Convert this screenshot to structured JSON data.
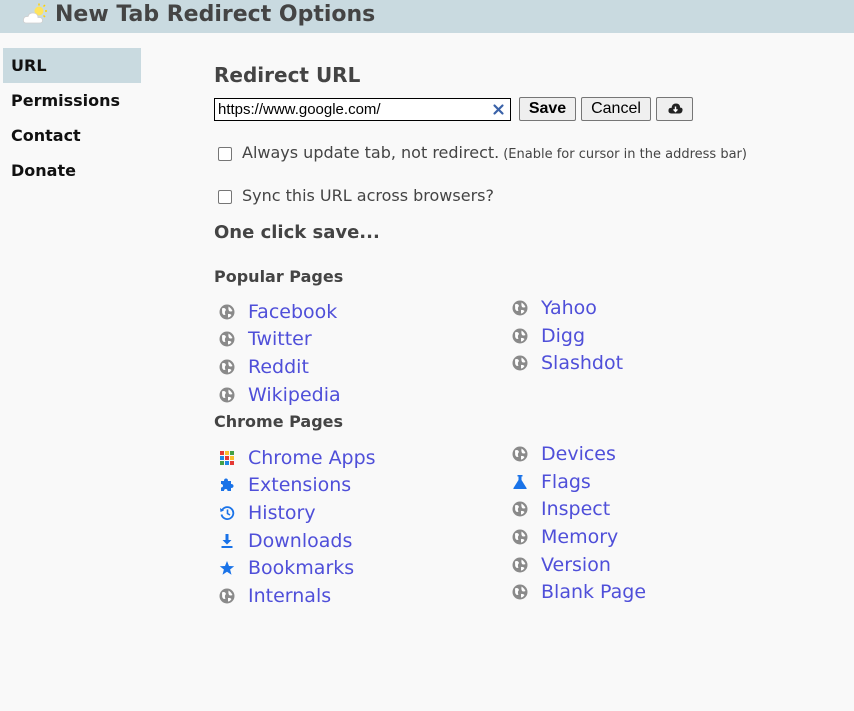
{
  "header": {
    "title": "New Tab Redirect Options",
    "logo": "sun-cloud-logo-icon"
  },
  "nav": {
    "items": [
      {
        "label": "URL",
        "active": true
      },
      {
        "label": "Permissions",
        "active": false
      },
      {
        "label": "Contact",
        "active": false
      },
      {
        "label": "Donate",
        "active": false
      }
    ]
  },
  "main": {
    "heading": "Redirect URL",
    "url_value": "https://www.google.com/",
    "save_label": "Save",
    "cancel_label": "Cancel",
    "cloud_icon": "cloud-download-icon",
    "clear_icon": "close-icon",
    "always_update_label": "Always update tab, not redirect.",
    "always_update_hint": "(Enable for cursor in the address bar)",
    "always_update_checked": false,
    "sync_label": "Sync this URL across browsers?",
    "sync_checked": false,
    "one_click_heading": "One click save...",
    "popular_heading": "Popular Pages",
    "chrome_heading": "Chrome Pages",
    "popular_links": [
      {
        "label": "Facebook",
        "icon": "globe-icon"
      },
      {
        "label": "Twitter",
        "icon": "globe-icon"
      },
      {
        "label": "Reddit",
        "icon": "globe-icon"
      },
      {
        "label": "Wikipedia",
        "icon": "globe-icon"
      },
      {
        "label": "Yahoo",
        "icon": "globe-icon"
      },
      {
        "label": "Digg",
        "icon": "globe-icon"
      },
      {
        "label": "Slashdot",
        "icon": "globe-icon"
      }
    ],
    "chrome_links": [
      {
        "label": "Chrome Apps",
        "icon": "apps-grid-icon"
      },
      {
        "label": "Extensions",
        "icon": "puzzle-icon"
      },
      {
        "label": "History",
        "icon": "history-icon"
      },
      {
        "label": "Downloads",
        "icon": "download-icon"
      },
      {
        "label": "Bookmarks",
        "icon": "star-icon"
      },
      {
        "label": "Internals",
        "icon": "globe-icon"
      },
      {
        "label": "Devices",
        "icon": "globe-icon"
      },
      {
        "label": "Flags",
        "icon": "flask-icon"
      },
      {
        "label": "Inspect",
        "icon": "globe-icon"
      },
      {
        "label": "Memory",
        "icon": "globe-icon"
      },
      {
        "label": "Version",
        "icon": "globe-icon"
      },
      {
        "label": "Blank Page",
        "icon": "globe-icon"
      }
    ]
  },
  "colors": {
    "header_bg": "#c9dae0",
    "link": "#4f4fd9",
    "icon_gray": "#8a8a8a",
    "icon_blue": "#1a73e8"
  }
}
